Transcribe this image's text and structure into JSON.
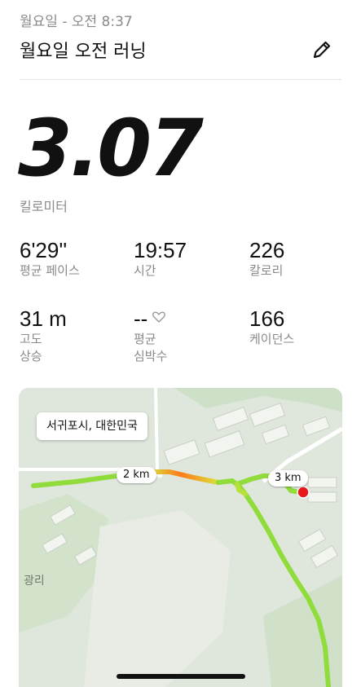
{
  "header": {
    "date": "월요일 - 오전 8:37",
    "title": "월요일 오전 러닝"
  },
  "distance": {
    "value": "3.07",
    "unit": "킬로미터"
  },
  "stats": [
    {
      "value": "6'29''",
      "label": "평균 페이스"
    },
    {
      "value": "19:57",
      "label": "시간"
    },
    {
      "value": "226",
      "label": "칼로리"
    },
    {
      "value": "31 m",
      "label": "고도\n상승"
    },
    {
      "value": "--",
      "label": "평균\n심박수"
    },
    {
      "value": "166",
      "label": "케이던스"
    }
  ],
  "map": {
    "location": "서귀포시, 대한민국",
    "km_markers": [
      "2 km",
      "3 km"
    ],
    "place_label": "광리"
  },
  "icons": {
    "edit": "pencil-icon",
    "heart": "heart-outline-icon"
  },
  "colors": {
    "route_main": "#8fdc3a",
    "route_fast": "#ff7a1a",
    "end_marker": "#e8191d",
    "map_bg": "#dfe6dc"
  }
}
